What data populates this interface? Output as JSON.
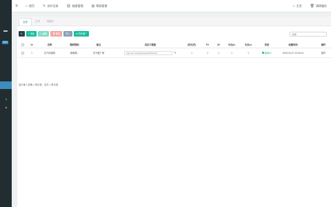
{
  "nav": {
    "links": [
      {
        "icon": "home-icon",
        "glyph": "⌂",
        "label": "首页"
      },
      {
        "icon": "pencil-icon",
        "glyph": "✎",
        "label": "访问记录"
      },
      {
        "icon": "link-icon",
        "glyph": "⛓",
        "label": "链接管理"
      },
      {
        "icon": "book-icon",
        "glyph": "▤",
        "label": "帮助管理"
      }
    ],
    "right": [
      {
        "icon": "home-icon",
        "glyph": "⌂",
        "label": "主页"
      },
      {
        "icon": "trash-icon",
        "glyph": "🗑",
        "label": "清除缓存"
      }
    ]
  },
  "sidebar": {
    "badge": "PRO"
  },
  "tabs": [
    "全部",
    "正常",
    "隐藏中"
  ],
  "toolbar": {
    "add": "+ 添加",
    "edit": "✎ 编辑",
    "delete": "🗑 删除",
    "import": "导入",
    "pull": "⚙ 同步推广"
  },
  "search": {
    "placeholder": "搜索"
  },
  "table": {
    "columns": [
      "Id",
      "名称",
      "跳转规则",
      "备注",
      "自定义链接",
      "访问(次)",
      "PV",
      "UV",
      "今日pv",
      "今日uv",
      "状态",
      "创建时间",
      "操作"
    ],
    "rows": [
      {
        "id": "1",
        "name": "生气的猫咪",
        "rule": "按照顺...",
        "note": "生气推广网",
        "url": "http://ezt.com/admin/index?fKtdX.hh",
        "visits": "1",
        "pv": "1",
        "uv": "1",
        "today_pv": "1",
        "today_uv": "1",
        "status": "使用中",
        "created": "2025-04-07 12:54:01",
        "op": "操作"
      }
    ]
  },
  "footer": "显示第 1 到第 1 条记录，总共 1 条记录",
  "colors": {
    "primary": "#3c8dbc",
    "success": "#18bc9c",
    "sidebar": "#222d32",
    "dark_button": "#2c3e50"
  }
}
